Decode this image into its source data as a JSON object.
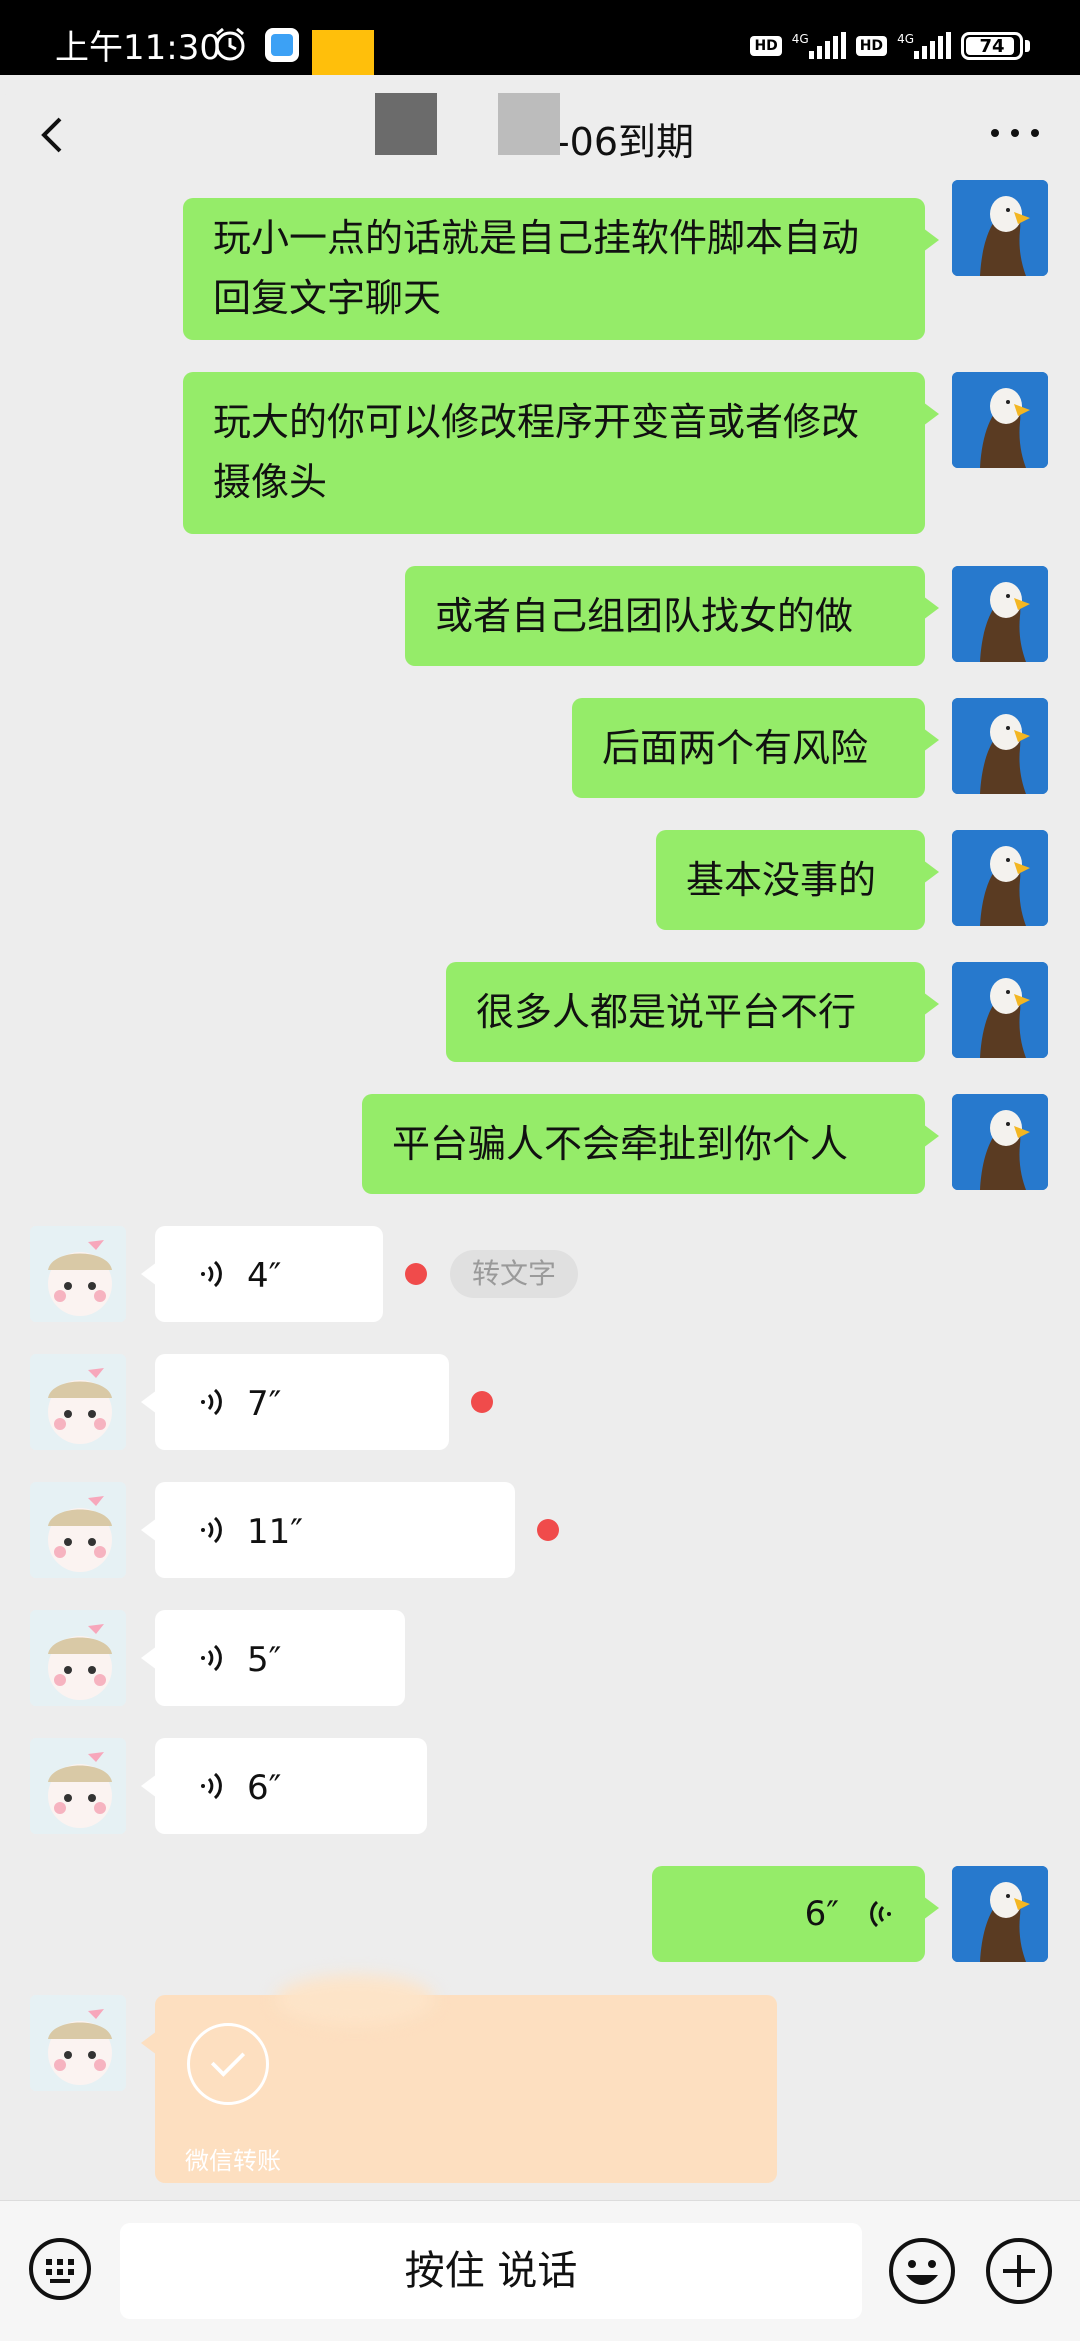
{
  "status_bar": {
    "time": "上午11:30",
    "network_1": "4G",
    "network_2": "4G",
    "hd_1": "HD",
    "hd_2": "HD",
    "battery": "74"
  },
  "header": {
    "title": "-06到期"
  },
  "messages": {
    "out_1": "玩小一点的话就是自己挂软件脚本自动回复文字聊天",
    "out_2": "玩大的你可以修改程序开变音或者修改摄像头",
    "out_3": "或者自己组团队找女的做",
    "out_4": "后面两个有风险",
    "out_5": "基本没事的",
    "out_6": "很多人都是说平台不行",
    "out_7": "平台骗人不会牵扯到你个人",
    "voice_in_1": "4″",
    "voice_in_2": "7″",
    "voice_in_3": "11″",
    "voice_in_4": "5″",
    "voice_in_5": "6″",
    "voice_out_1": "6″",
    "to_text": "转文字"
  },
  "transfer": {
    "label": "微信转账"
  },
  "bottom_bar": {
    "talk_label": "按住 说话"
  },
  "colors": {
    "outgoing_bubble": "#95ec69",
    "incoming_bubble": "#ffffff",
    "unread_dot": "#f04b4b",
    "transfer_card": "#fddfc0"
  }
}
